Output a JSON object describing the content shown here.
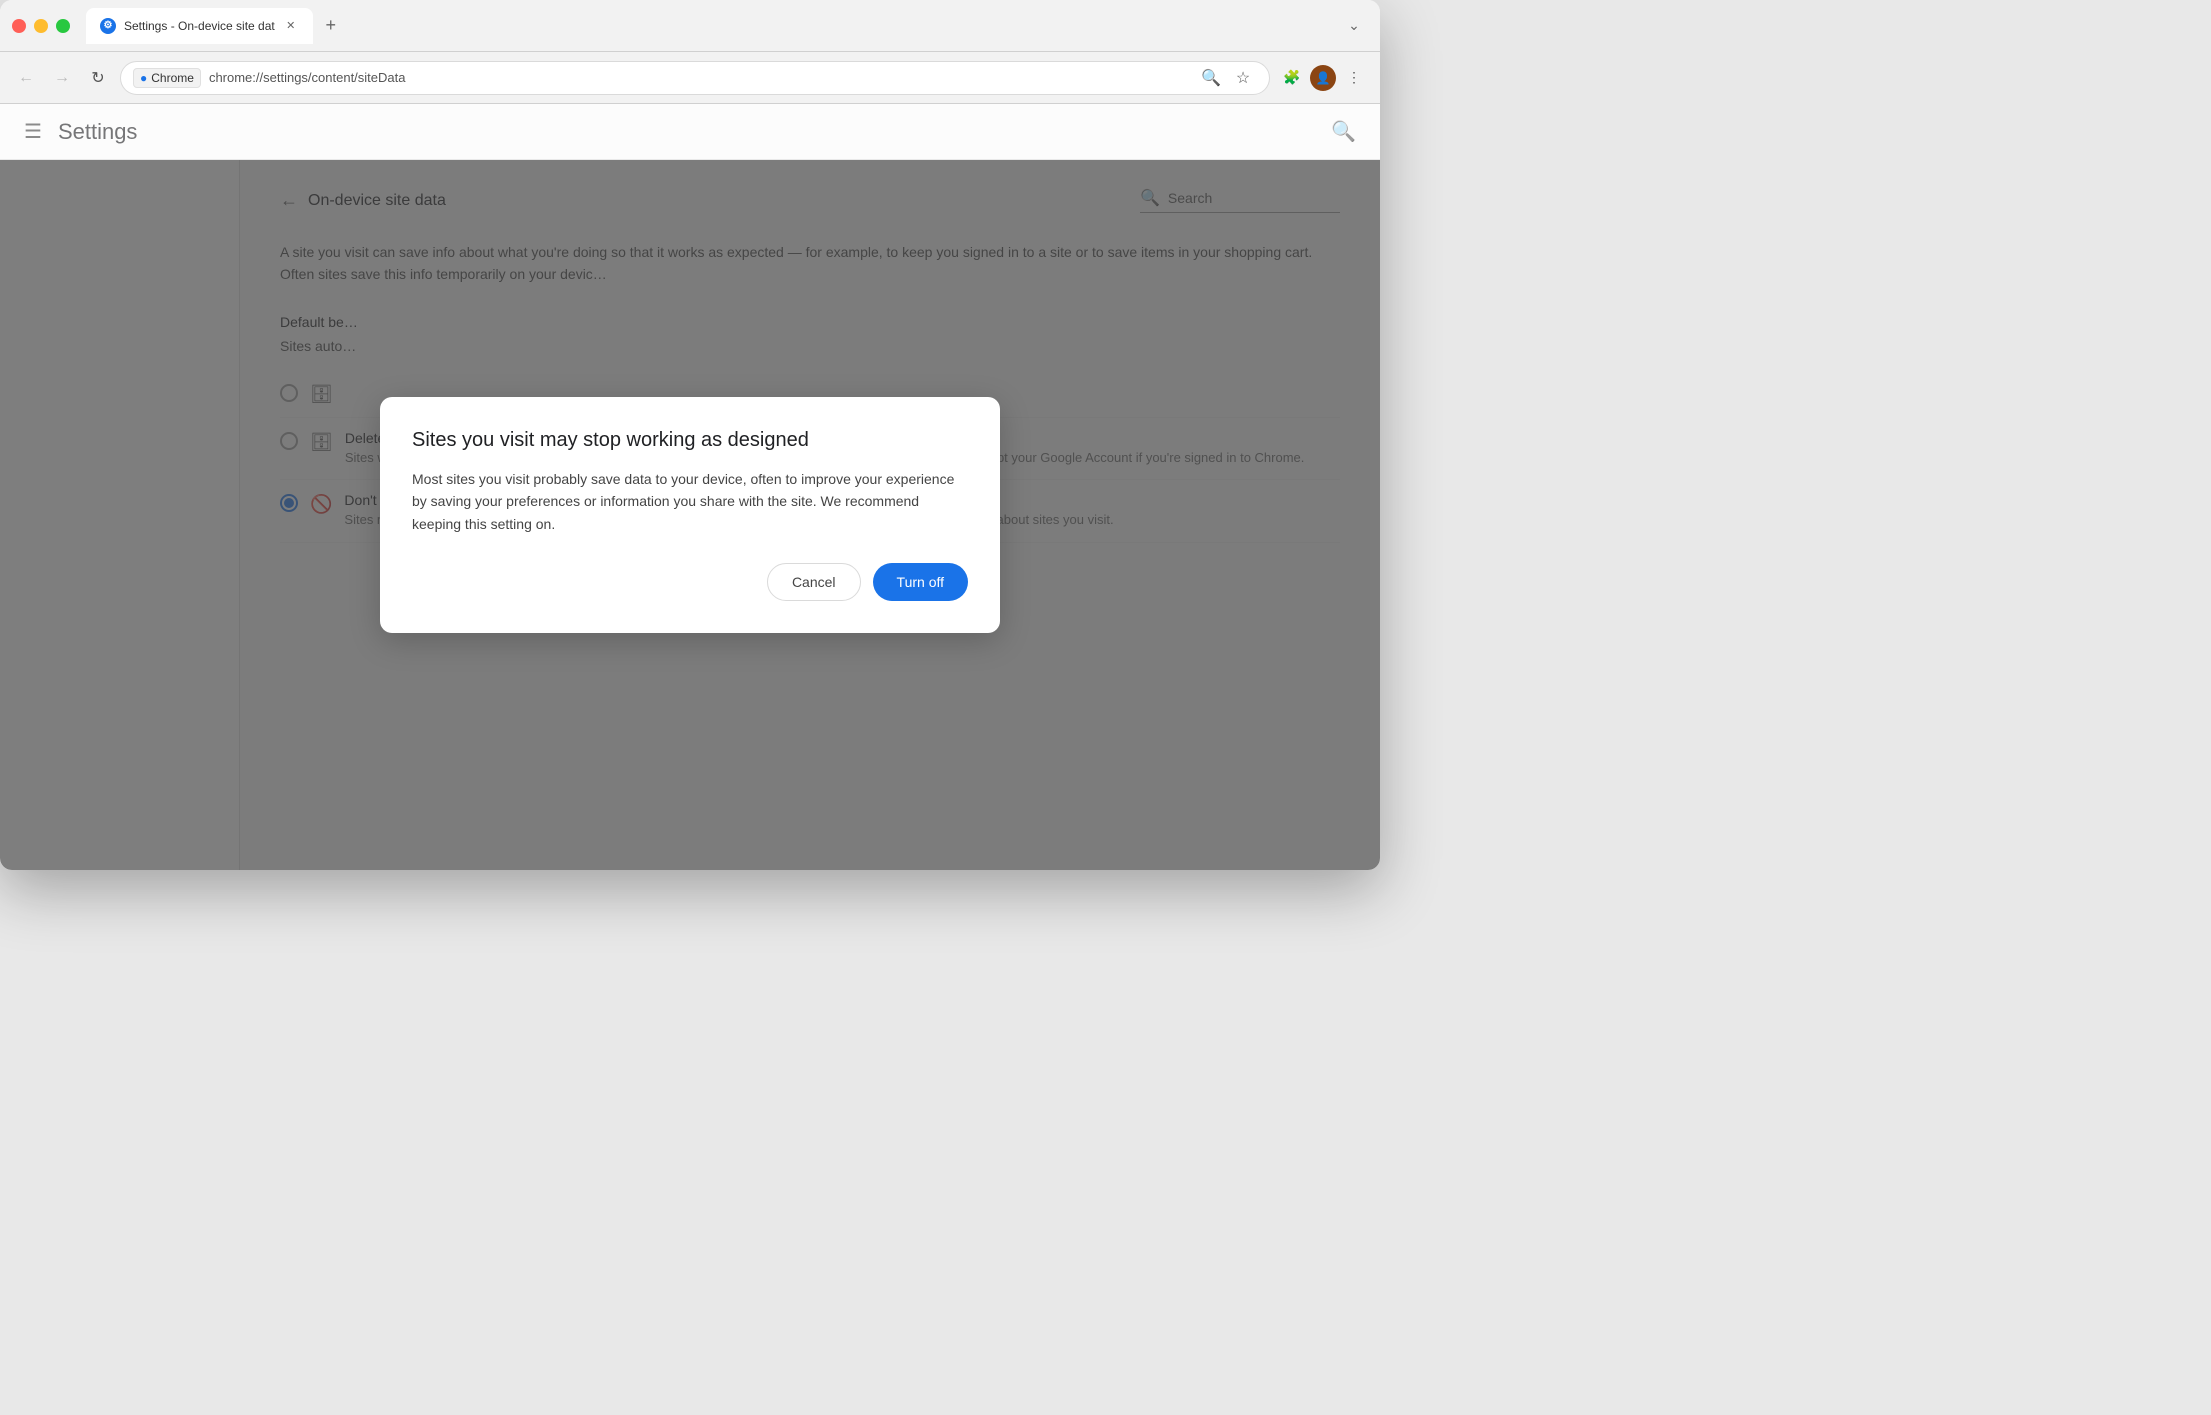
{
  "browser": {
    "tab_title": "Settings - On-device site dat",
    "tab_icon": "⚙",
    "url": "chrome://settings/content/siteData",
    "badge_label": "Chrome",
    "new_tab_label": "+",
    "dropdown_label": "⌄"
  },
  "nav": {
    "back_label": "←",
    "forward_label": "→",
    "refresh_label": "↻"
  },
  "toolbar": {
    "zoom_icon": "🔍",
    "bookmark_icon": "☆",
    "extensions_icon": "🧩",
    "menu_icon": "⋮"
  },
  "settings": {
    "menu_icon": "☰",
    "title": "Settings",
    "search_icon": "🔍",
    "page_title": "On-device site data",
    "back_arrow": "←",
    "search_label": "Search",
    "description": "A site you visit can save info about what you're doing so that it works as expected — for example, to keep you signed in to a site or to save items in your shopping cart. Often sites save this info temporarily on your devic…",
    "default_behavior_label": "Default be…",
    "sites_auto_label": "Sites auto…",
    "option1": {
      "radio_state": "unchecked",
      "icon": "🗄",
      "text": ""
    },
    "option2": {
      "radio_state": "unchecked",
      "icon": "🗄",
      "title": "Delete data sites have saved to your device when you close all windows",
      "subtitle": "Sites will probably work as expected. You'll be signed out of most sites when you close all Chrome windows, except your Google Account if you're signed in to Chrome."
    },
    "option3": {
      "radio_state": "checked",
      "icon": "🚫",
      "title": "Don't allow sites to save data on your device (not recommended)",
      "subtitle": "Sites may not work as you would expect. Choose this option if you don't want to leave information on your device about sites you visit."
    }
  },
  "dialog": {
    "title": "Sites you visit may stop working as designed",
    "body": "Most sites you visit probably save data to your device, often to improve your experience by saving your preferences or information you share with the site. We recommend keeping this setting on.",
    "cancel_label": "Cancel",
    "turn_off_label": "Turn off"
  }
}
